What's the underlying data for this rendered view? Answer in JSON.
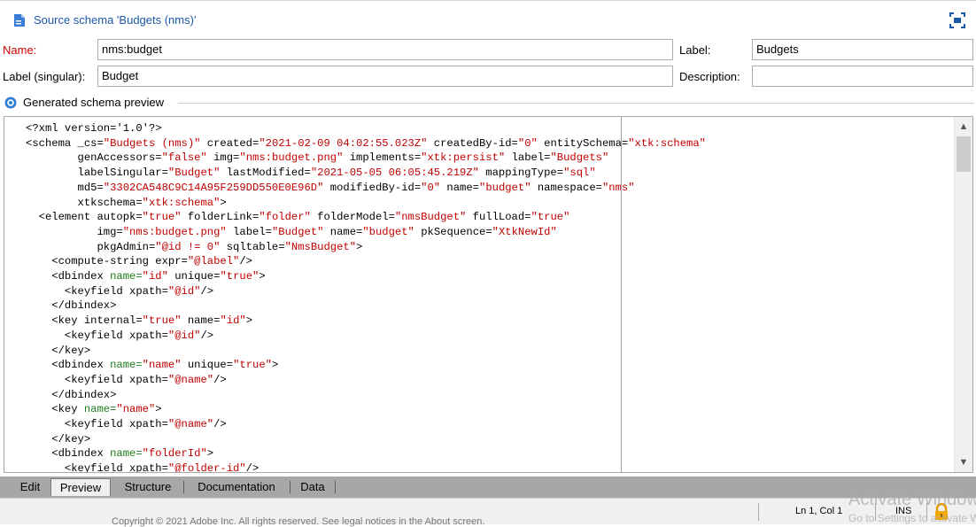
{
  "window": {
    "title": "Source schema 'Budgets (nms)'"
  },
  "form": {
    "name_label": "Name:",
    "name_value": "nms:budget",
    "label_label": "Label:",
    "label_value": "Budgets",
    "label_singular_label": "Label (singular):",
    "label_singular_value": "Budget",
    "description_label": "Description:",
    "description_value": ""
  },
  "preview": {
    "section_label": "Generated schema preview"
  },
  "code_lines": [
    [
      [
        "t",
        "<?xml version='1.0'?>"
      ]
    ],
    [
      [
        "t",
        "<schema _cs="
      ],
      [
        "v",
        "\"Budgets (nms)\""
      ],
      [
        "t",
        " created="
      ],
      [
        "v",
        "\"2021-02-09 04:02:55.023Z\""
      ],
      [
        "t",
        " createdBy-id="
      ],
      [
        "v",
        "\"0\""
      ],
      [
        "t",
        " entitySchema="
      ],
      [
        "v",
        "\"xtk:schema\""
      ]
    ],
    [
      [
        "t",
        "        genAccessors="
      ],
      [
        "v",
        "\"false\""
      ],
      [
        "t",
        " img="
      ],
      [
        "v",
        "\"nms:budget.png\""
      ],
      [
        "t",
        " implements="
      ],
      [
        "v",
        "\"xtk:persist\""
      ],
      [
        "t",
        " label="
      ],
      [
        "v",
        "\"Budgets\""
      ]
    ],
    [
      [
        "t",
        "        labelSingular="
      ],
      [
        "v",
        "\"Budget\""
      ],
      [
        "t",
        " lastModified="
      ],
      [
        "v",
        "\"2021-05-05 06:05:45.219Z\""
      ],
      [
        "t",
        " mappingType="
      ],
      [
        "v",
        "\"sql\""
      ]
    ],
    [
      [
        "t",
        "        md5="
      ],
      [
        "v",
        "\"3302CA548C9C14A95F259DD550E0E96D\""
      ],
      [
        "t",
        " modifiedBy-id="
      ],
      [
        "v",
        "\"0\""
      ],
      [
        "t",
        " name="
      ],
      [
        "v",
        "\"budget\""
      ],
      [
        "t",
        " namespace="
      ],
      [
        "v",
        "\"nms\""
      ]
    ],
    [
      [
        "t",
        "        xtkschema="
      ],
      [
        "v",
        "\"xtk:schema\""
      ],
      [
        "t",
        ">"
      ]
    ],
    [
      [
        "t",
        "  <element autopk="
      ],
      [
        "v",
        "\"true\""
      ],
      [
        "t",
        " folderLink="
      ],
      [
        "v",
        "\"folder\""
      ],
      [
        "t",
        " folderModel="
      ],
      [
        "v",
        "\"nmsBudget\""
      ],
      [
        "t",
        " fullLoad="
      ],
      [
        "v",
        "\"true\""
      ]
    ],
    [
      [
        "t",
        "           img="
      ],
      [
        "v",
        "\"nms:budget.png\""
      ],
      [
        "t",
        " label="
      ],
      [
        "v",
        "\"Budget\""
      ],
      [
        "t",
        " name="
      ],
      [
        "v",
        "\"budget\""
      ],
      [
        "t",
        " pkSequence="
      ],
      [
        "v",
        "\"XtkNewId\""
      ]
    ],
    [
      [
        "t",
        "           pkgAdmin="
      ],
      [
        "v",
        "\"@id != 0\""
      ],
      [
        "t",
        " sqltable="
      ],
      [
        "v",
        "\"NmsBudget\""
      ],
      [
        "t",
        ">"
      ]
    ],
    [
      [
        "t",
        "    <compute-string expr="
      ],
      [
        "v",
        "\"@label\""
      ],
      [
        "t",
        "/>"
      ]
    ],
    [
      [
        "t",
        "    <dbindex "
      ],
      [
        "n",
        "name="
      ],
      [
        "v",
        "\"id\""
      ],
      [
        "t",
        " unique="
      ],
      [
        "v",
        "\"true\""
      ],
      [
        "t",
        ">"
      ]
    ],
    [
      [
        "t",
        "      <keyfield xpath="
      ],
      [
        "v",
        "\"@id\""
      ],
      [
        "t",
        "/>"
      ]
    ],
    [
      [
        "t",
        "    </dbindex>"
      ]
    ],
    [
      [
        "t",
        "    <key internal="
      ],
      [
        "v",
        "\"true\""
      ],
      [
        "t",
        " name="
      ],
      [
        "v",
        "\"id\""
      ],
      [
        "t",
        ">"
      ]
    ],
    [
      [
        "t",
        "      <keyfield xpath="
      ],
      [
        "v",
        "\"@id\""
      ],
      [
        "t",
        "/>"
      ]
    ],
    [
      [
        "t",
        "    </key>"
      ]
    ],
    [
      [
        "t",
        "    <dbindex "
      ],
      [
        "n",
        "name="
      ],
      [
        "v",
        "\"name\""
      ],
      [
        "t",
        " unique="
      ],
      [
        "v",
        "\"true\""
      ],
      [
        "t",
        ">"
      ]
    ],
    [
      [
        "t",
        "      <keyfield xpath="
      ],
      [
        "v",
        "\"@name\""
      ],
      [
        "t",
        "/>"
      ]
    ],
    [
      [
        "t",
        "    </dbindex>"
      ]
    ],
    [
      [
        "t",
        "    <key "
      ],
      [
        "n",
        "name="
      ],
      [
        "v",
        "\"name\""
      ],
      [
        "t",
        ">"
      ]
    ],
    [
      [
        "t",
        "      <keyfield xpath="
      ],
      [
        "v",
        "\"@name\""
      ],
      [
        "t",
        "/>"
      ]
    ],
    [
      [
        "t",
        "    </key>"
      ]
    ],
    [
      [
        "t",
        "    <dbindex "
      ],
      [
        "n",
        "name="
      ],
      [
        "v",
        "\"folderId\""
      ],
      [
        "t",
        ">"
      ]
    ],
    [
      [
        "t",
        "      <keyfield xpath="
      ],
      [
        "v",
        "\"@folder-id\""
      ],
      [
        "t",
        "/>"
      ]
    ]
  ],
  "tabs": [
    {
      "label": "Edit",
      "active": false
    },
    {
      "label": "Preview",
      "active": true
    },
    {
      "label": "Structure",
      "active": false
    },
    {
      "label": "Documentation",
      "active": false
    },
    {
      "label": "Data",
      "active": false
    }
  ],
  "status": {
    "position": "Ln 1, Col 1",
    "mode": "INS",
    "watermark_line1": "Activate Windows",
    "watermark_line2": "Go to Settings to activate Windows.",
    "copyright": "Copyright © 2021 Adobe Inc. All rights reserved. See legal notices in the About screen."
  },
  "colors": {
    "title": "#1c58a8",
    "required_label": "#d00000",
    "xml_value": "#c00000",
    "xml_name_attr": "#1a7c1a"
  },
  "icons": [
    "schema-icon",
    "maximize-icon",
    "eye-icon",
    "scroll-up-icon",
    "scroll-down-icon",
    "lock-icon"
  ]
}
